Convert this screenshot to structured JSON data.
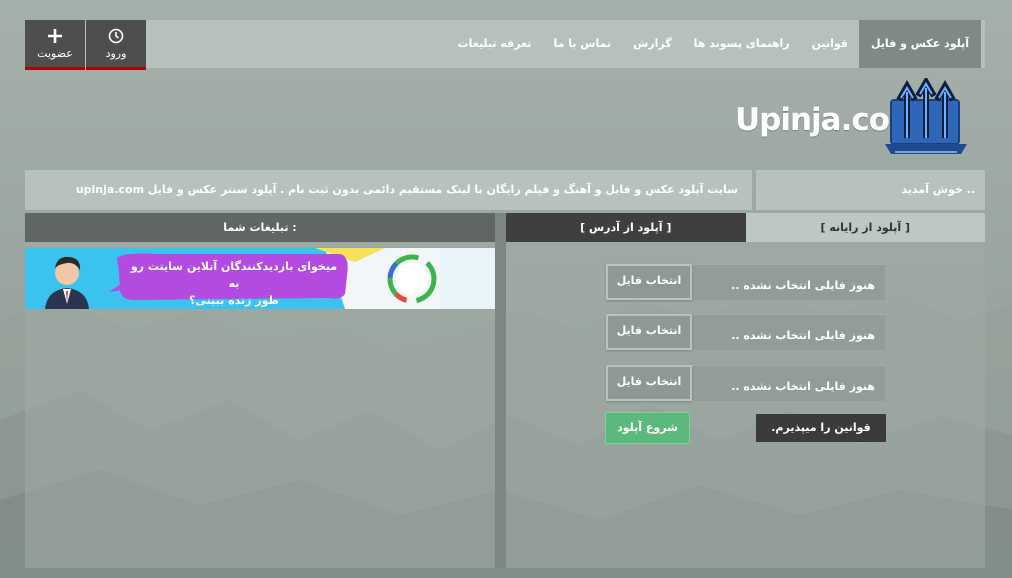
{
  "nav": {
    "items": [
      {
        "label": "آپلود عکس و فایل",
        "active": true
      },
      {
        "label": "قوانین"
      },
      {
        "label": "راهنمای پسوند ها"
      },
      {
        "label": "گزارش"
      },
      {
        "label": "تماس با ما"
      },
      {
        "label": "تعرفه تبلیغات"
      }
    ]
  },
  "auth": {
    "login_label": "ورود",
    "register_label": "عضویت"
  },
  "logo": {
    "text": "Upinja.com"
  },
  "welcome": {
    "greeting": "خوش آمدید ..",
    "description": "سایت آپلود عکس و فایل و آهنگ و فیلم رایگان با لینک مستقیم دائمی بدون ثبت نام . آپلود سنتر عکس و فایل upinja.com"
  },
  "ads": {
    "header": "تبلیغات شما :",
    "banner_text_line1": "میخوای بازدیدکنندگان آنلاین سایتت رو به",
    "banner_text_line2": "طور زنده ببینی؟"
  },
  "upload": {
    "tab_local": "[ آپلود از رایانه ]",
    "tab_url": "[ آپلود از آدرس ]",
    "files": [
      {
        "status": "هنوز فایلی انتخاب نشده ..",
        "button": "انتخاب فایل"
      },
      {
        "status": "هنوز فایلی انتخاب نشده ..",
        "button": "انتخاب فایل"
      },
      {
        "status": "هنوز فایلی انتخاب نشده ..",
        "button": "انتخاب فایل"
      }
    ],
    "start_label": "شروع آپلود",
    "rules_label": "قوانین را میپذیرم."
  },
  "colors": {
    "accent_green": "#5cb97e",
    "dark_button": "#3b3b3b",
    "auth_border": "#b40000"
  }
}
